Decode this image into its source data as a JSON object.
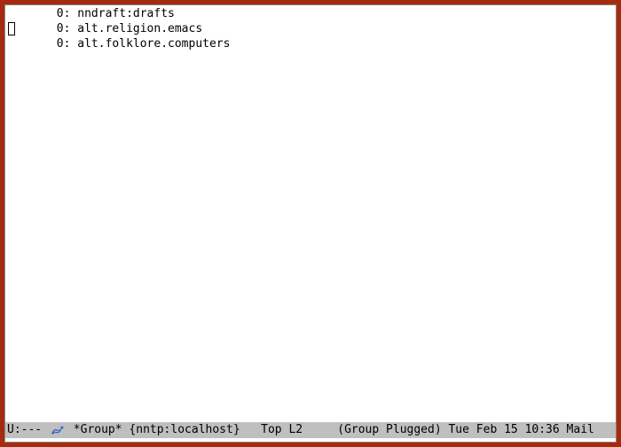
{
  "buffer": {
    "lines": [
      {
        "count": "0",
        "name": "nndraft:drafts"
      },
      {
        "count": "0",
        "name": "alt.religion.emacs"
      },
      {
        "count": "0",
        "name": "alt.folklore.computers"
      }
    ]
  },
  "modeline": {
    "state": "U:--- ",
    "buffer_name": "*Group*",
    "server": "{nntp:localhost}",
    "position": "Top",
    "line": "L2",
    "mode": "(Group Plugged)",
    "time": "Tue Feb 15 10:36",
    "misc": "Mail"
  }
}
